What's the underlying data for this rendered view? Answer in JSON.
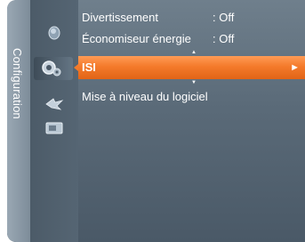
{
  "side_tab": {
    "label": "Configuration"
  },
  "icons": [
    {
      "name": "picture-icon"
    },
    {
      "name": "setup-gear-icon"
    },
    {
      "name": "input-icon"
    },
    {
      "name": "application-icon"
    }
  ],
  "menu": {
    "items": [
      {
        "label": "Divertissement",
        "value": ": Off"
      },
      {
        "label": "Économiseur énergie",
        "value": ": Off"
      },
      {
        "label": "ISI",
        "value": "",
        "arrow": "►"
      },
      {
        "label": "Mise à niveau du logiciel",
        "value": ""
      }
    ]
  },
  "colors": {
    "highlight": "#f47a2b",
    "panel": "#5a6a78",
    "text": "#ffffff"
  }
}
